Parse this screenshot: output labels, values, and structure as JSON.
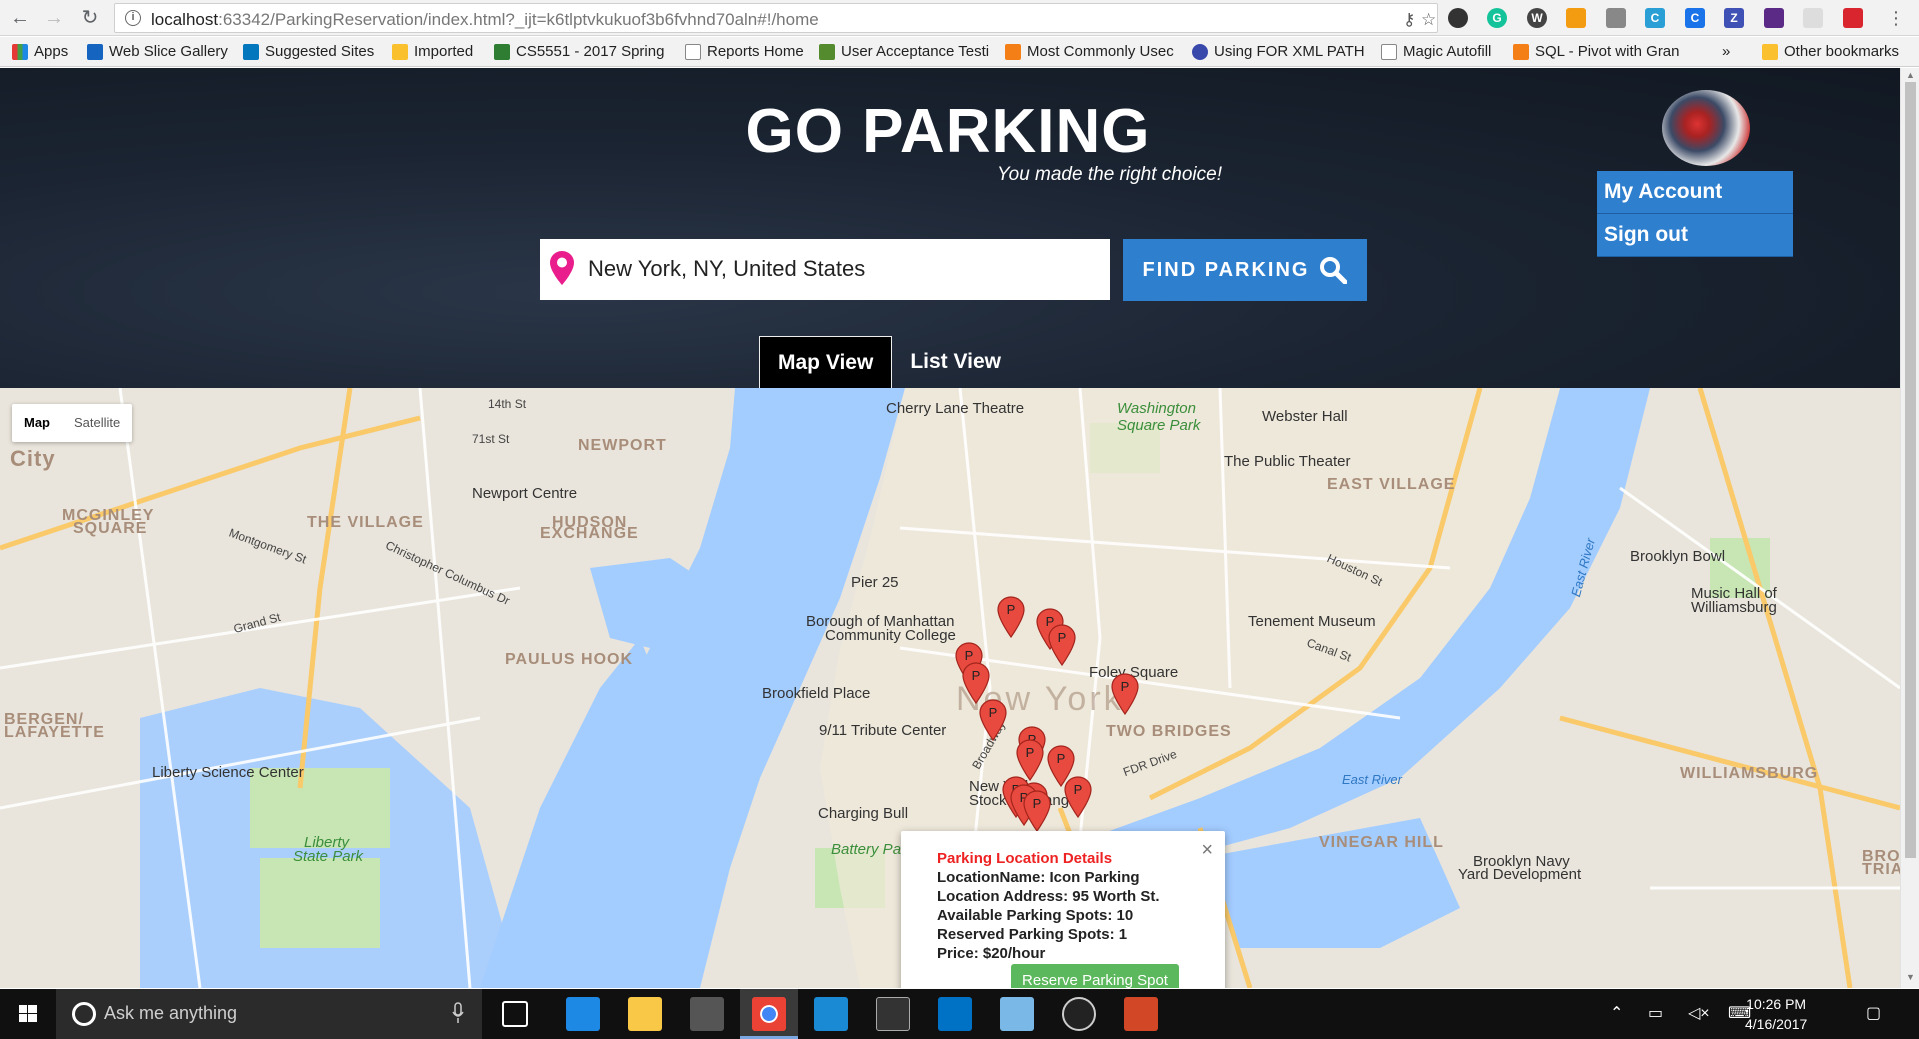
{
  "browser": {
    "url_host": "localhost",
    "url_path": ":63342/ParkingReservation/index.html?_ijt=k6tlptvkukuof3b6fvhnd70aln#!/home",
    "bookmarks": [
      "Apps",
      "Web Slice Gallery",
      "Suggested Sites",
      "Imported",
      "CS5551 - 2017 Spring",
      "Reports Home",
      "User Acceptance Testi",
      "Most Commonly Usec",
      "Using FOR XML PATH",
      "Magic Autofill",
      "SQL - Pivot with Gran",
      "»",
      "Other bookmarks"
    ]
  },
  "header": {
    "title": "GO PARKING",
    "subtitle": "You made the right choice!",
    "account_menu": [
      "My Account",
      "Sign out"
    ]
  },
  "search": {
    "value": "New York, NY, United States",
    "button_label": "FIND PARKING"
  },
  "tabs": [
    {
      "label": "Map View",
      "active": true
    },
    {
      "label": "List View",
      "active": false
    }
  ],
  "map": {
    "type_controls": [
      "Map",
      "Satellite"
    ],
    "places": [
      "Cherry Lane Theatre",
      "Washington",
      "Square Park",
      "Webster Hall",
      "The Public Theater",
      "EAST VILLAGE",
      "NEWPORT",
      "Newport Centre",
      "HUDSON",
      "EXCHANGE",
      "THE VILLAGE",
      "MCGINLEY",
      "SQUARE",
      "PAULUS HOOK",
      "Pier 25",
      "Borough of Manhattan",
      "Community College",
      "Brookfield Place",
      "9/11 Tribute Center",
      "Foley Square",
      "TWO BRIDGES",
      "Tenement Museum",
      "Brooklyn Bowl",
      "Music Hall of",
      "Williamsburg",
      "WILLIAMSBURG",
      "New York",
      "New York",
      "Stock Exchange",
      "Charging Bull",
      "Battery Park",
      "VINEGAR HILL",
      "Brooklyn Navy",
      "Yard Development",
      "Liberty Science Center",
      "Liberty",
      "State Park",
      "BERGEN/",
      "LAFAYETTE",
      "City",
      "BROAD",
      "TRIAN",
      "East River",
      "East River",
      "FDR Drive"
    ],
    "roads": [
      "14th St",
      "71st St",
      "Grand St",
      "Montgomery St",
      "Christopher Columbus Dr",
      "Broadway",
      "Canal St",
      "Houston St"
    ],
    "popup": {
      "title": "Parking Location Details",
      "location_name": "LocationName: Icon Parking",
      "address": "Location Address: 95 Worth St.",
      "available": "Available Parking Spots: 10",
      "reserved": "Reserved Parking Spots: 1",
      "price": "Price: $20/hour",
      "button": "Reserve Parking Spot",
      "close": "×"
    },
    "marker_label": "P",
    "marker_color": "#e84a3f"
  },
  "taskbar": {
    "search_placeholder": "Ask me anything",
    "time": "10:26 PM",
    "date": "4/16/2017"
  },
  "colors": {
    "accent": "#2f7fcf",
    "reserve": "#5cb85c",
    "water": "#a3ccff",
    "park": "#c8e6b4"
  }
}
